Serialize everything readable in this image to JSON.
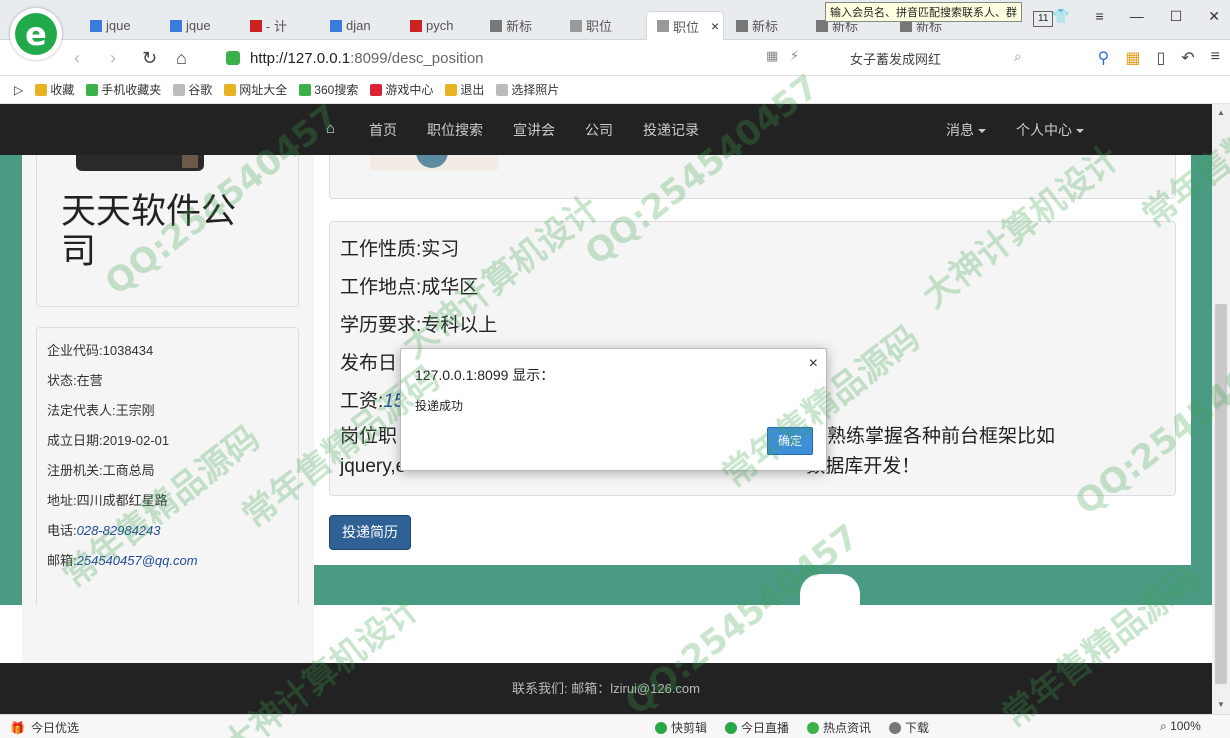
{
  "browser": {
    "tabs": [
      {
        "label": "jque",
        "color": "#3b7ddd"
      },
      {
        "label": "jque",
        "color": "#3b7ddd"
      },
      {
        "label": "- 计",
        "color": "#cc2222"
      },
      {
        "label": "djan",
        "color": "#3b7ddd"
      },
      {
        "label": "pych",
        "color": "#cc2222"
      },
      {
        "label": "新标",
        "color": "#777"
      },
      {
        "label": "职位",
        "color": "#999"
      },
      {
        "label": "职位",
        "color": "#999"
      },
      {
        "label": "新标",
        "color": "#777"
      },
      {
        "label": "新标",
        "color": "#777"
      },
      {
        "label": "新标",
        "color": "#777"
      }
    ],
    "active_tab": 7,
    "tooltip": "输入会员名、拼音匹配搜索联系人、群",
    "tab_count": "11",
    "url_host": "http://127.0.0.1",
    "url_path": ":8099/desc_position",
    "search_text": "女子蓄发成网红",
    "favorites": [
      {
        "label": "收藏",
        "color": "#e8b320"
      },
      {
        "label": "手机收藏夹",
        "color": "#3cb04a"
      },
      {
        "label": "谷歌",
        "color": "#bbb"
      },
      {
        "label": "网址大全",
        "color": "#e8b320"
      },
      {
        "label": "360搜索",
        "color": "#3cb04a"
      },
      {
        "label": "游戏中心",
        "color": "#d23"
      },
      {
        "label": "退出",
        "color": "#e8b320"
      },
      {
        "label": "选择照片",
        "color": "#bbb"
      }
    ]
  },
  "nav": {
    "links": [
      "首页",
      "职位搜索",
      "宣讲会",
      "公司",
      "投递记录"
    ],
    "messages": "消息",
    "profile": "个人中心"
  },
  "company": {
    "name": "天天软件公司",
    "info": [
      {
        "label": "企业代码:",
        "value": "1038434",
        "link": false
      },
      {
        "label": "状态:",
        "value": "在营",
        "link": false
      },
      {
        "label": "法定代表人:",
        "value": "王宗刚",
        "link": false
      },
      {
        "label": "成立日期:",
        "value": "2019-02-01",
        "link": false
      },
      {
        "label": "注册机关:",
        "value": "工商总局",
        "link": false
      },
      {
        "label": "地址:",
        "value": "四川成都红星路",
        "link": false
      },
      {
        "label": "电话:",
        "value": "028-82984243",
        "link": true
      },
      {
        "label": "邮箱:",
        "value": "254540457@qq.com",
        "link": true
      }
    ]
  },
  "job": {
    "nature": "工作性质:实习",
    "location": "工作地点:成华区",
    "education": "学历要求:专科以上",
    "date_label": "发布日",
    "salary_label": "工资:",
    "salary_visible": "15",
    "desc_part1": "岗位职",
    "desc_part1b": "熟练掌握各种前台框架比如",
    "desc_part2": "jquery,e",
    "desc_part2b": "数据库开发！",
    "apply_button": "投递简历"
  },
  "footer": {
    "text": "联系我们:  邮箱：lzirui@126.com"
  },
  "dialog": {
    "title": "127.0.0.1:8099 显示：",
    "message": "投递成功",
    "ok": "确定"
  },
  "status": {
    "left": "今日优选",
    "items": [
      "快剪辑",
      "今日直播",
      "热点资讯",
      "下载"
    ],
    "zoom": "100%"
  },
  "watermarks": [
    "QQ:254540457",
    "常年售精品源码",
    "大神计算机设计"
  ]
}
